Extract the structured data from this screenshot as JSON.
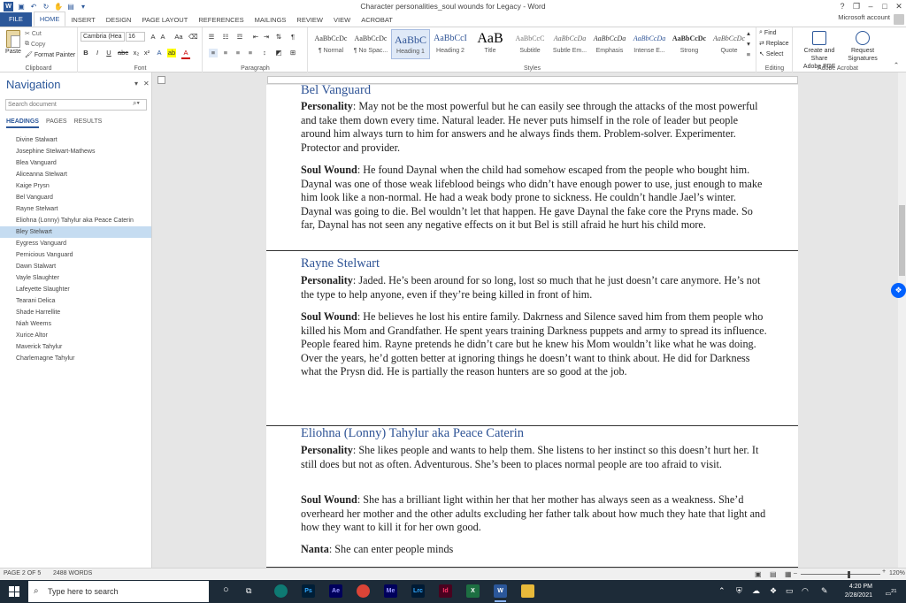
{
  "window": {
    "title": "Character personalities_soul wounds for Legacy - Word",
    "controls": [
      "?",
      "❐",
      "–",
      "□",
      "✕"
    ]
  },
  "ribbon_tabs": [
    "FILE",
    "HOME",
    "INSERT",
    "DESIGN",
    "PAGE LAYOUT",
    "REFERENCES",
    "MAILINGS",
    "REVIEW",
    "VIEW",
    "ACROBAT"
  ],
  "account": "Microsoft account",
  "clipboard": {
    "paste": "Paste",
    "cut": "Cut",
    "copy": "Copy",
    "format_painter": "Format Painter",
    "label": "Clipboard"
  },
  "font": {
    "name": "Cambria (Hea",
    "size": "16",
    "label": "Font"
  },
  "paragraph": {
    "label": "Paragraph"
  },
  "styles": {
    "label": "Styles",
    "items": [
      {
        "preview": "AaBbCcDc",
        "name": "¶ Normal"
      },
      {
        "preview": "AaBbCcDc",
        "name": "¶ No Spac..."
      },
      {
        "preview": "AaBbC",
        "name": "Heading 1"
      },
      {
        "preview": "AaBbCcI",
        "name": "Heading 2"
      },
      {
        "preview": "AaB",
        "name": "Title"
      },
      {
        "preview": "AaBbCcC",
        "name": "Subtitle"
      },
      {
        "preview": "AaBbCcDa",
        "name": "Subtle Em..."
      },
      {
        "preview": "AaBbCcDa",
        "name": "Emphasis"
      },
      {
        "preview": "AaBbCcDa",
        "name": "Intense E..."
      },
      {
        "preview": "AaBbCcDc",
        "name": "Strong"
      },
      {
        "preview": "AaBbCcDc",
        "name": "Quote"
      }
    ]
  },
  "editing": {
    "find": "Find",
    "replace": "Replace",
    "select": "Select",
    "label": "Editing"
  },
  "acrobat": {
    "create_share": "Create and Share",
    "adobe_pdf": "Adobe PDF",
    "request": "Request",
    "signatures": "Signatures",
    "label": "Adobe Acrobat"
  },
  "navigation": {
    "title": "Navigation",
    "search_placeholder": "Search document",
    "tabs": [
      "HEADINGS",
      "PAGES",
      "RESULTS"
    ],
    "items": [
      "Divine Stalwart",
      "Josephine Stelwart-Mathews",
      "Blea Vanguard",
      "Aliceanna Stelwart",
      "Kaige Prysn",
      "Bel Vanguard",
      "Rayne Stelwart",
      "Eliohna (Lonny) Tahylur  aka Peace Caterin",
      "Bley Stelwart",
      "Eygress Vanguard",
      "Pernicious Vanguard",
      "Dawn Stalwart",
      "Vayle Slaughter",
      "Lafeyette Slaughter",
      "Tearani Delica",
      "Shade Harrellite",
      "Niah Weems",
      "Xurice Altor",
      "Maverick Tahylur",
      "Charlemagne Tahylur"
    ],
    "selected_index": 8
  },
  "document": {
    "bel": {
      "heading": "Bel Vanguard",
      "personality_label": "Personality",
      "personality": ": May not be the most powerful but he can easily see through the attacks of the most powerful and take them down every time. Natural leader. He never puts himself in the role of leader but people around him always turn to him for answers and he always finds them. Problem-solver. Experimenter. Protector and provider.",
      "wound_label": "Soul Wound",
      "wound": ": He found Daynal when the child had somehow escaped from the people who bought him. Daynal was one of those weak lifeblood beings who didn’t have enough power to use, just enough to make him look like a non-normal. He had a weak body prone to sickness. He couldn’t handle Jael’s winter. Daynal was going to die. Bel wouldn’t let that happen. He gave Daynal the fake core the Pryns made. So far, Daynal has not seen any negative effects on it but Bel is still afraid he hurt his child more."
    },
    "rayne": {
      "heading": "Rayne Stelwart",
      "personality_label": "Personality",
      "personality": ": Jaded. He’s been around for so long, lost so much that he just doesn’t care anymore. He’s not the type to help anyone, even if they’re being killed in front of him.",
      "wound_label": "Soul Wound",
      "wound": ": He believes he lost his entire family. Dakrness and Silence saved him from them people who killed his Mom and Grandfather.  He spent years training Darkness puppets and army to spread its influence. People feared him. Rayne pretends he didn’t care but he knew his Mom wouldn’t like what he was doing. Over the years, he’d gotten better at ignoring things he doesn’t want to think about. He did for Darkness what the Prysn did. He is partially the reason hunters are so good at the job."
    },
    "lonny": {
      "heading": "Eliohna (Lonny) Tahylur  aka Peace Caterin",
      "personality_label": "Personality",
      "personality": ": She likes people and wants to help them. She listens to her instinct so this doesn’t hurt her. It still does but not as often. Adventurous. She’s been to places normal people are too afraid to visit.",
      "wound_label": "Soul Wound",
      "wound": ": She has a brilliant light within her that her mother has always seen as a weakness. She’d overheard her mother and the other adults excluding her father talk about how much they hate that light and how they want to kill it for her own good.",
      "nanta_label": "Nanta",
      "nanta": ": She can enter people minds"
    }
  },
  "status": {
    "page": "PAGE 2 OF 5",
    "words": "2488 WORDS",
    "zoom": "120%"
  },
  "taskbar": {
    "search_placeholder": "Type here to search",
    "apps": [
      {
        "label": "Ps",
        "color": "#001e36",
        "fg": "#31a8ff"
      },
      {
        "label": "Ae",
        "color": "#00005b",
        "fg": "#9999ff"
      },
      {
        "label": "",
        "color": "#db4437",
        "fg": "#fff"
      },
      {
        "label": "Me",
        "color": "#00005b",
        "fg": "#9999ff"
      },
      {
        "label": "Lrc",
        "color": "#001a33",
        "fg": "#31a8ff"
      },
      {
        "label": "Id",
        "color": "#49021f",
        "fg": "#ff3366"
      },
      {
        "label": "X",
        "color": "#1d6f42",
        "fg": "#fff"
      },
      {
        "label": "W",
        "color": "#2b579a",
        "fg": "#fff"
      },
      {
        "label": "",
        "color": "#e8b93a",
        "fg": "#fff"
      }
    ],
    "time": "4:20 PM",
    "date": "2/28/2021",
    "notifications": "21"
  }
}
